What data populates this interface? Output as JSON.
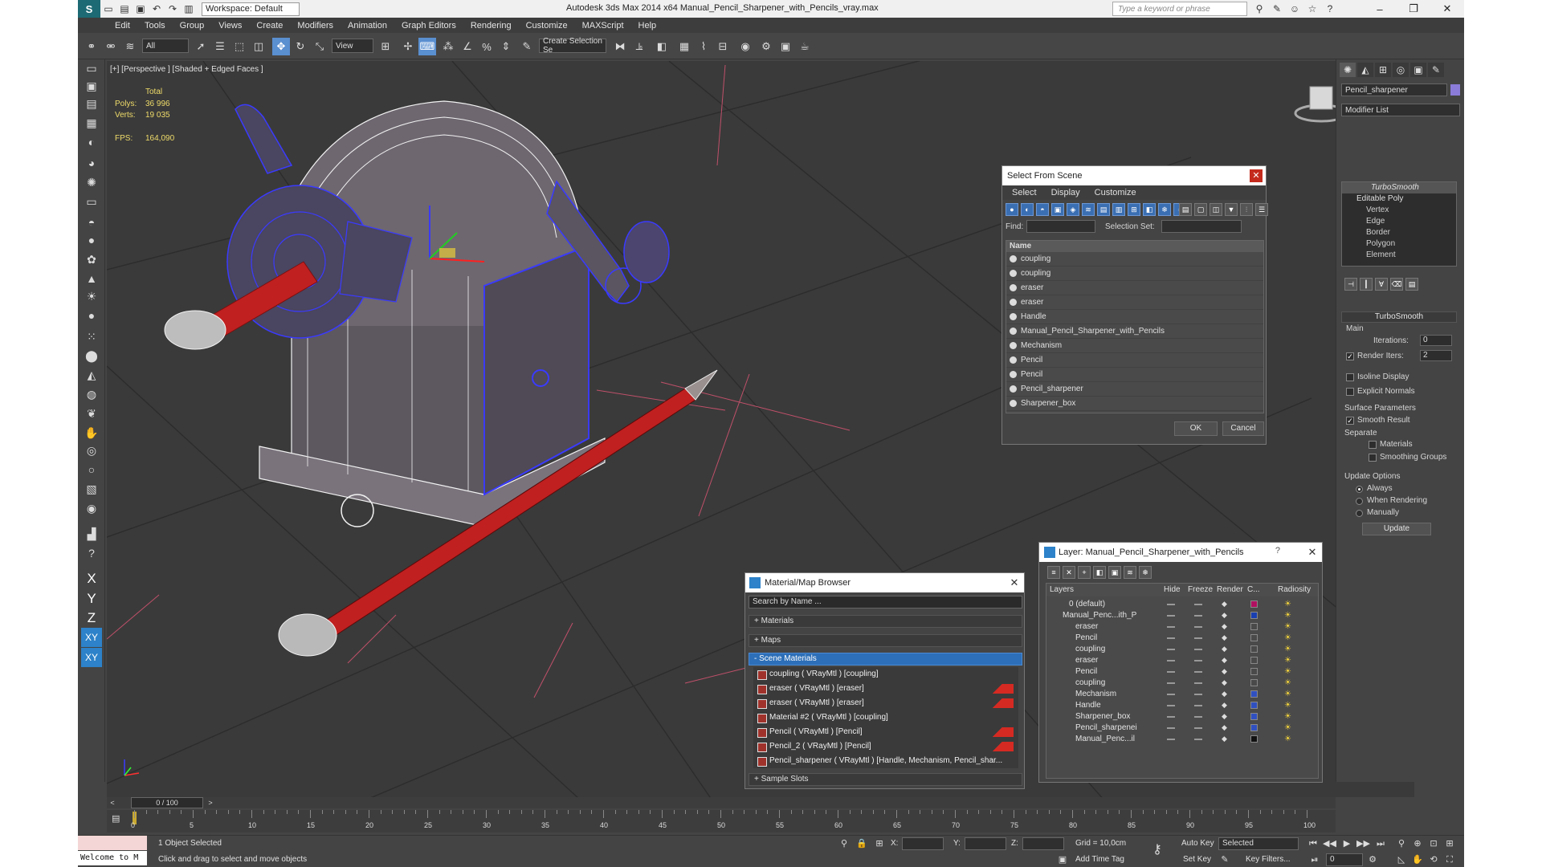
{
  "app": {
    "title": "Autodesk 3ds Max  2014 x64     Manual_Pencil_Sharpener_with_Pencils_vray.max",
    "workspace": "Workspace: Default",
    "search_placeholder": "Type a keyword or phrase"
  },
  "menu": [
    "Edit",
    "Tools",
    "Group",
    "Views",
    "Create",
    "Modifiers",
    "Animation",
    "Graph Editors",
    "Rendering",
    "Customize",
    "MAXScript",
    "Help"
  ],
  "toolbar": {
    "selection_filter": "All",
    "ref_coord": "View",
    "named_selection_placeholder": "Create Selection Se"
  },
  "viewport": {
    "label": "[+] [Perspective ] [Shaded + Edged Faces ]",
    "stats_total": "Total",
    "polys_label": "Polys:",
    "polys_value": "36 996",
    "verts_label": "Verts:",
    "verts_value": "19 035",
    "fps_label": "FPS:",
    "fps_value": "164,090"
  },
  "command_panel": {
    "object_name": "Pencil_sharpener",
    "modifier_list": "Modifier List",
    "stack": {
      "turbosmooth": "TurboSmooth",
      "editable_poly": "Editable Poly",
      "subs": [
        "Vertex",
        "Edge",
        "Border",
        "Polygon",
        "Element"
      ]
    },
    "rollout_title": "TurboSmooth",
    "main": "Main",
    "iterations_label": "Iterations:",
    "iterations_value": "0",
    "render_iters_label": "Render Iters:",
    "render_iters_value": "2",
    "isoline": "Isoline Display",
    "explicit_normals": "Explicit Normals",
    "surface_params": "Surface Parameters",
    "smooth_result": "Smooth Result",
    "separate": "Separate",
    "materials": "Materials",
    "smoothing_groups": "Smoothing Groups",
    "update_options": "Update Options",
    "always": "Always",
    "when_rendering": "When Rendering",
    "manually": "Manually",
    "update_btn": "Update"
  },
  "select_from_scene": {
    "title": "Select From Scene",
    "menu": [
      "Select",
      "Display",
      "Customize"
    ],
    "find_label": "Find:",
    "selection_set_label": "Selection Set:",
    "col_name": "Name",
    "items": [
      "coupling",
      "coupling",
      "eraser",
      "eraser",
      "Handle",
      "Manual_Pencil_Sharpener_with_Pencils",
      "Mechanism",
      "Pencil",
      "Pencil",
      "Pencil_sharpener",
      "Sharpener_box"
    ],
    "ok": "OK",
    "cancel": "Cancel"
  },
  "material_browser": {
    "title": "Material/Map Browser",
    "search_placeholder": "Search by Name ...",
    "sections": {
      "materials": "+ Materials",
      "maps": "+ Maps",
      "scene_materials": "- Scene Materials",
      "sample_slots": "+ Sample Slots"
    },
    "items": [
      "coupling  ( VRayMtl )  [coupling]",
      "eraser  ( VRayMtl )  [eraser]",
      "eraser  ( VRayMtl )  [eraser]",
      "Material #2  ( VRayMtl )  [coupling]",
      "Pencil  ( VRayMtl )  [Pencil]",
      "Pencil_2  ( VRayMtl )  [Pencil]",
      "Pencil_sharpener  ( VRayMtl )  [Handle, Mechanism, Pencil_shar..."
    ]
  },
  "layer_manager": {
    "title": "Layer: Manual_Pencil_Sharpener_with_Pencils",
    "help": "?",
    "columns": [
      "Layers",
      "Hide",
      "Freeze",
      "Render",
      "C...",
      "Radiosity"
    ],
    "rows": [
      {
        "name": "0 (default)",
        "color": "#b01060"
      },
      {
        "name": "Manual_Penc...ith_P",
        "color": "#1a3fb0"
      },
      {
        "name": "eraser",
        "color": ""
      },
      {
        "name": "Pencil",
        "color": ""
      },
      {
        "name": "coupling",
        "color": ""
      },
      {
        "name": "eraser",
        "color": ""
      },
      {
        "name": "Pencil",
        "color": ""
      },
      {
        "name": "coupling",
        "color": ""
      },
      {
        "name": "Mechanism",
        "color": "#3050c0"
      },
      {
        "name": "Handle",
        "color": "#3050c0"
      },
      {
        "name": "Sharpener_box",
        "color": "#3050c0"
      },
      {
        "name": "Pencil_sharpenei",
        "color": "#3050c0"
      },
      {
        "name": "Manual_Penc...il",
        "color": "#111111"
      }
    ]
  },
  "timeline": {
    "frame_range": "0 / 100",
    "ticks": [
      "0",
      "5",
      "10",
      "15",
      "20",
      "25",
      "30",
      "35",
      "40",
      "45",
      "50",
      "55",
      "60",
      "65",
      "70",
      "75",
      "80",
      "85",
      "90",
      "95",
      "100"
    ]
  },
  "status": {
    "listener": "Welcome to M",
    "selection": "1 Object Selected",
    "prompt": "Click and drag to select and move objects",
    "x_label": "X:",
    "y_label": "Y:",
    "z_label": "Z:",
    "grid": "Grid = 10,0cm",
    "add_time_tag": "Add Time Tag",
    "auto_key": "Auto Key",
    "set_key": "Set Key",
    "key_mode": "Selected",
    "key_filters": "Key Filters...",
    "frame": "0"
  },
  "colors": {
    "accent": "#2d82c9",
    "wire_blue": "#3a3aff",
    "pencil_red": "#c02020"
  }
}
